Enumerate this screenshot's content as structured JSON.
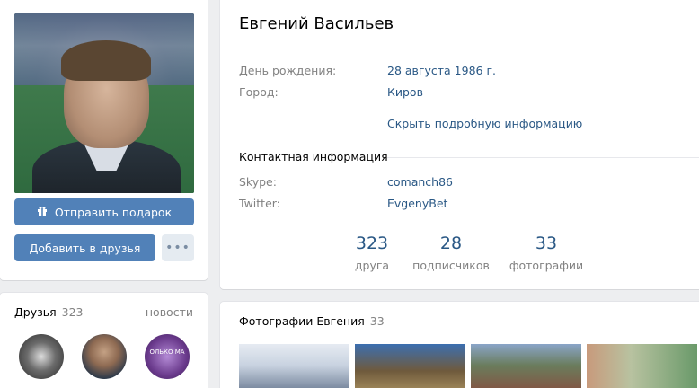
{
  "profile": {
    "name": "Евгений Васильев",
    "details": [
      {
        "label": "День рождения:",
        "value": "28 августа 1986 г."
      },
      {
        "label": "Город:",
        "value": "Киров"
      }
    ],
    "toggle_info": "Скрыть подробную информацию",
    "contact_title": "Контактная информация",
    "contacts": [
      {
        "label": "Skype:",
        "value": "comanch86"
      },
      {
        "label": "Twitter:",
        "value": "EvgenyBet"
      }
    ],
    "counters": [
      {
        "num": "323",
        "label": "друга"
      },
      {
        "num": "28",
        "label": "подписчиков"
      },
      {
        "num": "33",
        "label": "фотографии"
      }
    ]
  },
  "actions": {
    "gift_label": "Отправить подарок",
    "gift_icon": "gift-icon",
    "add_friend_label": "Добавить в друзья",
    "more_label": "•••"
  },
  "friends": {
    "title": "Друзья",
    "count": "323",
    "news_link": "новости",
    "avatar3_text": "ОЛЬКО МА"
  },
  "photos": {
    "title": "Фотографии Евгения",
    "count": "33"
  },
  "colors": {
    "accent": "#5181b8",
    "link": "#2a5885",
    "muted": "#828282",
    "background": "#edeef0"
  }
}
